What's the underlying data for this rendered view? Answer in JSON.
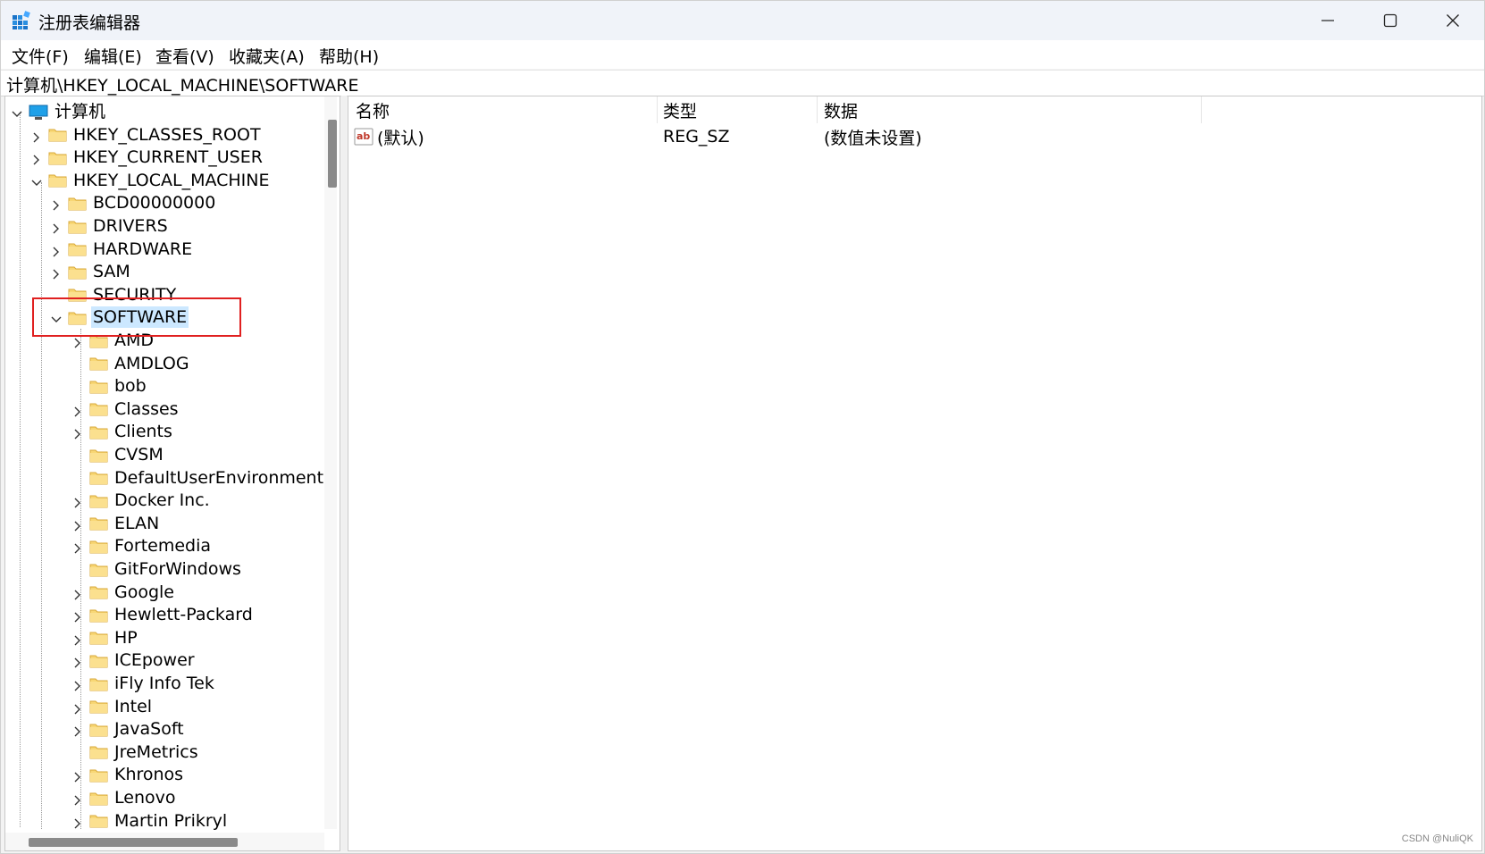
{
  "window": {
    "title": "注册表编辑器",
    "icons": {
      "app": "registry-editor-icon",
      "minimize": "minimize-icon",
      "maximize": "maximize-icon",
      "close": "close-icon"
    }
  },
  "menu": [
    "文件(F)",
    "编辑(E)",
    "查看(V)",
    "收藏夹(A)",
    "帮助(H)"
  ],
  "address": {
    "path": "计算机\\HKEY_LOCAL_MACHINE\\SOFTWARE"
  },
  "tree": {
    "root": "计算机",
    "hives": [
      "HKEY_CLASSES_ROOT",
      "HKEY_CURRENT_USER",
      "HKEY_LOCAL_MACHINE"
    ],
    "hklm_children": [
      "BCD00000000",
      "DRIVERS",
      "HARDWARE",
      "SAM",
      "SECURITY",
      "SOFTWARE"
    ],
    "selected": "SOFTWARE",
    "software_children": [
      "AMD",
      "AMDLOG",
      "bob",
      "Classes",
      "Clients",
      "CVSM",
      "DefaultUserEnvironment",
      "Docker Inc.",
      "ELAN",
      "Fortemedia",
      "GitForWindows",
      "Google",
      "Hewlett-Packard",
      "HP",
      "ICEpower",
      "iFly Info Tek",
      "Intel",
      "JavaSoft",
      "JreMetrics",
      "Khronos",
      "Lenovo",
      "Martin Prikryl"
    ]
  },
  "list": {
    "columns": [
      "名称",
      "类型",
      "数据"
    ],
    "rows": [
      {
        "name": "(默认)",
        "type": "REG_SZ",
        "data": "(数值未设置)"
      }
    ]
  },
  "watermark": "CSDN @NuliQK",
  "colors": {
    "selection": "#cce8ff",
    "highlight_box": "#e02020",
    "folder": "#f8d775",
    "titlebar": "#f0f3f9"
  }
}
